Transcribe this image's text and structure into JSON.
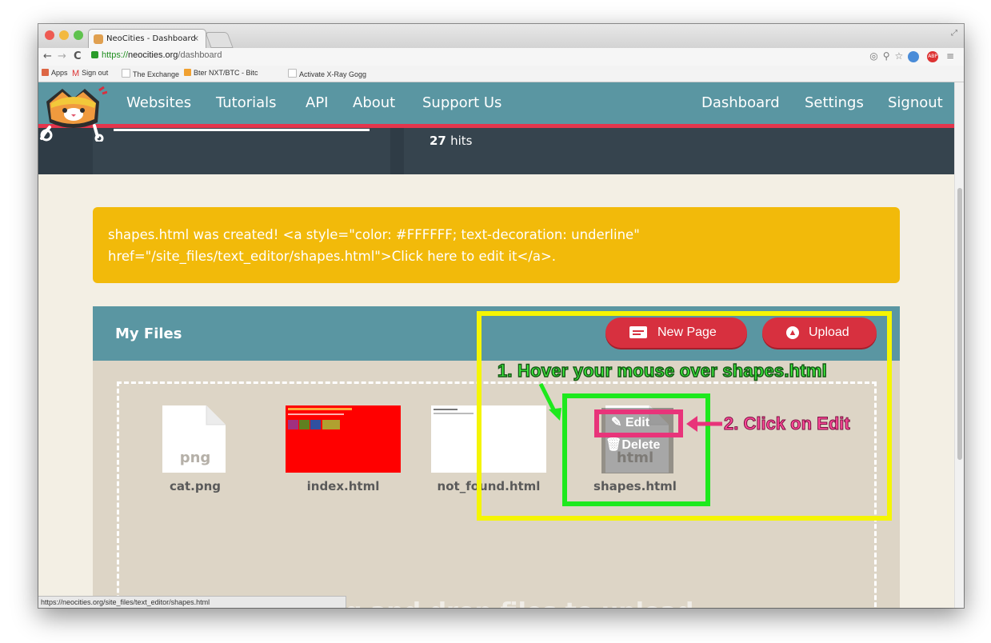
{
  "browser": {
    "tab_title": "NeoCities - Dashboard",
    "tab_close": "×",
    "url_https": "https://",
    "url_host": "neocities.org",
    "url_path": "/dashboard",
    "bookmarks": [
      "Apps",
      "Sign out",
      "The Exchange",
      "Bter NXT/BTC - Bitc",
      "Activate X-Ray Gogg"
    ],
    "status_url": "https://neocities.org/site_files/text_editor/shapes.html",
    "abp_label": "ABP"
  },
  "nav": {
    "left": [
      "Websites",
      "Tutorials",
      "API",
      "About",
      "Support Us"
    ],
    "right": [
      "Dashboard",
      "Settings",
      "Signout"
    ]
  },
  "stats": {
    "hits_value": "27",
    "hits_label": "hits"
  },
  "alert": {
    "line1": "shapes.html was created! <a style=\"color: #FFFFFF; text-decoration: underline\"",
    "line2": "href=\"/site_files/text_editor/shapes.html\">Click here to edit it</a>."
  },
  "files": {
    "title": "My Files",
    "new_page": "New Page",
    "upload": "Upload",
    "drop_text": "drag and drop files to upload",
    "items": [
      {
        "name": "cat.png",
        "ext_label": "png"
      },
      {
        "name": "index.html"
      },
      {
        "name": "not_found.html"
      },
      {
        "name": "shapes.html",
        "ext_label": "html"
      }
    ],
    "hover_actions": {
      "edit": "Edit",
      "delete": "Delete"
    }
  },
  "annotations": {
    "step1": "1. Hover your mouse over shapes.html",
    "step2": "2. Click on Edit"
  },
  "colors": {
    "navbar": "#5a96a2",
    "accent_red": "#e4354c",
    "alert": "#f2ba0a",
    "annotation_yellow": "#f5f504",
    "annotation_green": "#1de91d",
    "annotation_pink": "#e8347a"
  }
}
